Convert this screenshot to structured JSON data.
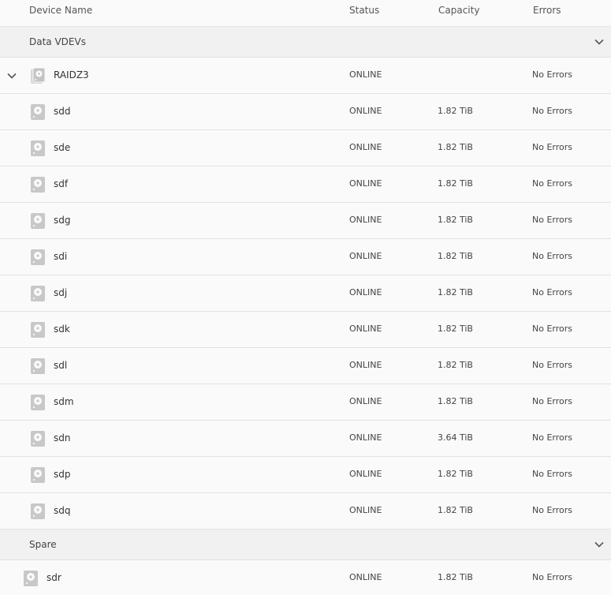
{
  "columns": {
    "name": "Device Name",
    "status": "Status",
    "capacity": "Capacity",
    "errors": "Errors"
  },
  "groups": {
    "data_vdevs": "Data VDEVs",
    "spare": "Spare"
  },
  "vdev": {
    "name": "RAIDZ3",
    "status": "ONLINE",
    "capacity": "",
    "errors": "No Errors"
  },
  "disks": [
    {
      "name": "sdd",
      "status": "ONLINE",
      "capacity": "1.82 TiB",
      "errors": "No Errors"
    },
    {
      "name": "sde",
      "status": "ONLINE",
      "capacity": "1.82 TiB",
      "errors": "No Errors"
    },
    {
      "name": "sdf",
      "status": "ONLINE",
      "capacity": "1.82 TiB",
      "errors": "No Errors"
    },
    {
      "name": "sdg",
      "status": "ONLINE",
      "capacity": "1.82 TiB",
      "errors": "No Errors"
    },
    {
      "name": "sdi",
      "status": "ONLINE",
      "capacity": "1.82 TiB",
      "errors": "No Errors"
    },
    {
      "name": "sdj",
      "status": "ONLINE",
      "capacity": "1.82 TiB",
      "errors": "No Errors"
    },
    {
      "name": "sdk",
      "status": "ONLINE",
      "capacity": "1.82 TiB",
      "errors": "No Errors"
    },
    {
      "name": "sdl",
      "status": "ONLINE",
      "capacity": "1.82 TiB",
      "errors": "No Errors"
    },
    {
      "name": "sdm",
      "status": "ONLINE",
      "capacity": "1.82 TiB",
      "errors": "No Errors"
    },
    {
      "name": "sdn",
      "status": "ONLINE",
      "capacity": "3.64 TiB",
      "errors": "No Errors"
    },
    {
      "name": "sdp",
      "status": "ONLINE",
      "capacity": "1.82 TiB",
      "errors": "No Errors"
    },
    {
      "name": "sdq",
      "status": "ONLINE",
      "capacity": "1.82 TiB",
      "errors": "No Errors"
    }
  ],
  "spare_disk": {
    "name": "sdr",
    "status": "ONLINE",
    "capacity": "1.82 TiB",
    "errors": "No Errors"
  },
  "icons": {
    "expand": "chevron-down-icon",
    "collapse": "chevron-down-icon",
    "disk": "hard-disk-icon",
    "vdev": "disk-stack-icon"
  },
  "colors": {
    "background": "#fafafa",
    "group_background": "#f1f1f1",
    "divider": "#e2e2e2",
    "icon": "#c8c8c8"
  }
}
